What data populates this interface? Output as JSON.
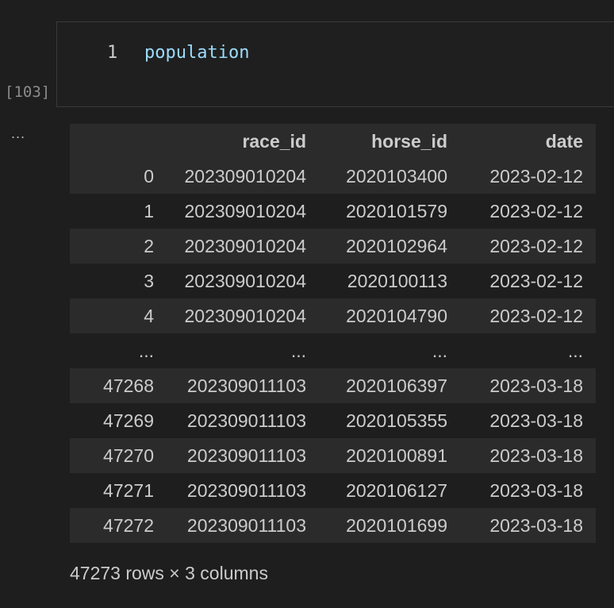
{
  "cell": {
    "execution_count": "[103]",
    "line_number": "1",
    "code": "population",
    "output_toggle": "..."
  },
  "dataframe": {
    "columns": [
      "",
      "race_id",
      "horse_id",
      "date"
    ],
    "rows": [
      [
        "0",
        "202309010204",
        "2020103400",
        "2023-02-12"
      ],
      [
        "1",
        "202309010204",
        "2020101579",
        "2023-02-12"
      ],
      [
        "2",
        "202309010204",
        "2020102964",
        "2023-02-12"
      ],
      [
        "3",
        "202309010204",
        "2020100113",
        "2023-02-12"
      ],
      [
        "4",
        "202309010204",
        "2020104790",
        "2023-02-12"
      ],
      [
        "...",
        "...",
        "...",
        "..."
      ],
      [
        "47268",
        "202309011103",
        "2020106397",
        "2023-03-18"
      ],
      [
        "47269",
        "202309011103",
        "2020105355",
        "2023-03-18"
      ],
      [
        "47270",
        "202309011103",
        "2020100891",
        "2023-03-18"
      ],
      [
        "47271",
        "202309011103",
        "2020106127",
        "2023-03-18"
      ],
      [
        "47272",
        "202309011103",
        "2020101699",
        "2023-03-18"
      ]
    ],
    "summary": "47273 rows × 3 columns"
  }
}
